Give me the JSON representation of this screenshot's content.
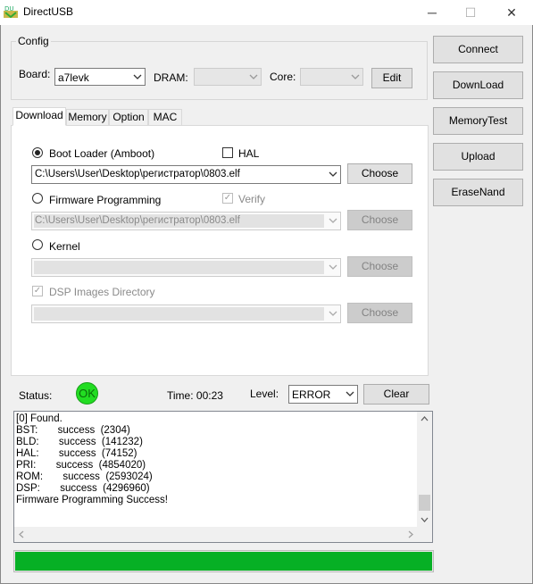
{
  "window": {
    "title": "DirectUSB",
    "minimize": "─",
    "maximize": "☐",
    "close": "✕"
  },
  "config": {
    "legend": "Config",
    "board_label": "Board:",
    "board_value": "a7levk",
    "dram_label": "DRAM:",
    "dram_value": "",
    "core_label": "Core:",
    "core_value": "",
    "edit_label": "Edit"
  },
  "side_buttons": {
    "connect": "Connect",
    "download": "DownLoad",
    "memorytest": "MemoryTest",
    "upload": "Upload",
    "erasenand": "EraseNand"
  },
  "tabs": {
    "download": "Download",
    "memory": "Memory",
    "option": "Option",
    "mac": "MAC"
  },
  "download": {
    "bootloader_label": "Boot Loader (Amboot)",
    "hal_label": "HAL",
    "bootloader_path": "C:\\Users\\User\\Desktop\\регистратор\\0803.elf",
    "firmware_label": "Firmware Programming",
    "verify_label": "Verify",
    "firmware_path": "C:\\Users\\User\\Desktop\\регистратор\\0803.elf",
    "kernel_label": "Kernel",
    "kernel_path": "",
    "dsp_label": "DSP Images Directory",
    "dsp_path": "",
    "choose_label": "Choose"
  },
  "status": {
    "label": "Status:",
    "indicator": "OK",
    "time": "Time: 00:23",
    "level_label": "Level:",
    "level_value": "ERROR",
    "clear_label": "Clear"
  },
  "log": {
    "lines": [
      "[0] Found.",
      "BST:       success  (2304)",
      "BLD:       success  (141232)",
      "HAL:       success  (74152)",
      "PRI:       success  (4854020)",
      "ROM:       success  (2593024)",
      "DSP:       success  (4296960)",
      "Firmware Programming Success!"
    ]
  },
  "progress_fraction": 1.0,
  "colors": {
    "progress_fill": "#06b025",
    "status_ok": "#22dd22",
    "titlebar": "#ffffff"
  }
}
